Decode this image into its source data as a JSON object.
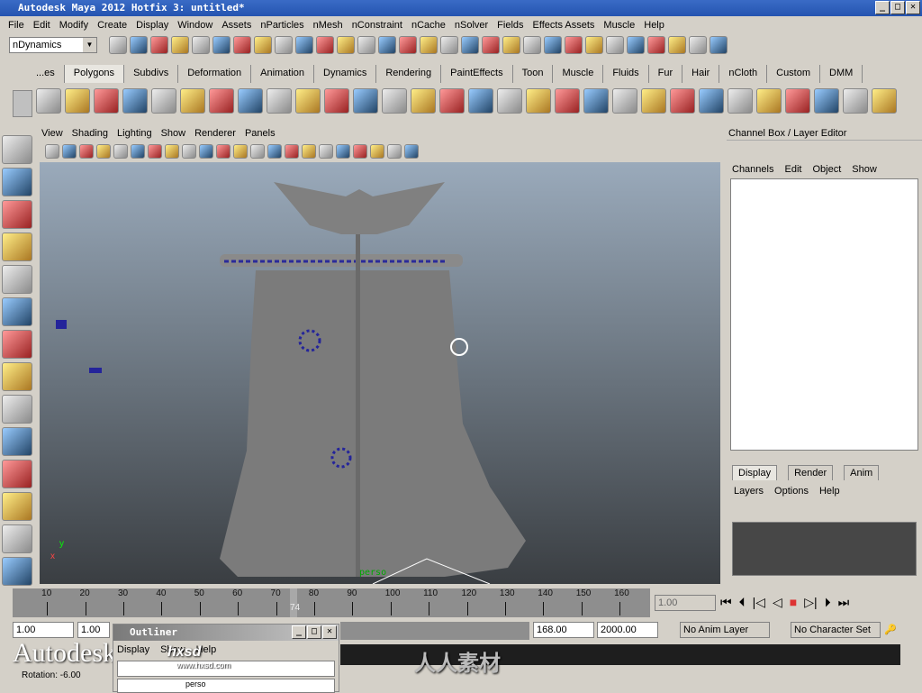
{
  "window": {
    "title": "Autodesk Maya 2012 Hotfix 3: untitled*"
  },
  "menu": [
    "File",
    "Edit",
    "Modify",
    "Create",
    "Display",
    "Window",
    "Assets",
    "nParticles",
    "nMesh",
    "nConstraint",
    "nCache",
    "nSolver",
    "Fields",
    "Effects Assets",
    "Muscle",
    "Help"
  ],
  "status_line": {
    "menu_set": "nDynamics"
  },
  "shelf_tabs": [
    "...es",
    "Polygons",
    "Subdivs",
    "Deformation",
    "Animation",
    "Dynamics",
    "Rendering",
    "PaintEffects",
    "Toon",
    "Muscle",
    "Fluids",
    "Fur",
    "Hair",
    "nCloth",
    "Custom",
    "DMM"
  ],
  "viewport": {
    "menu": [
      "View",
      "Shading",
      "Lighting",
      "Show",
      "Renderer",
      "Panels"
    ],
    "axis_y": "y",
    "axis_x": "x",
    "object_label": "perso"
  },
  "channel_box": {
    "title": "Channel Box / Layer Editor",
    "menu": [
      "Channels",
      "Edit",
      "Object",
      "Show"
    ],
    "tabs": [
      "Display",
      "Render",
      "Anim"
    ],
    "layer_menu": [
      "Layers",
      "Options",
      "Help"
    ]
  },
  "time_slider": {
    "ticks": [
      10,
      20,
      30,
      40,
      50,
      60,
      70,
      80,
      90,
      100,
      110,
      120,
      130,
      140,
      150,
      160
    ],
    "current_frame": "74",
    "current_time_field": "1.00"
  },
  "range_slider": {
    "start_time": "1.00",
    "playback_start": "1.00",
    "playback_end": "168.00",
    "end_time": "2000.00",
    "anim_layer": "No Anim Layer",
    "character_set": "No Character Set"
  },
  "outliner": {
    "title": "Outliner",
    "menu": [
      "Display",
      "Show",
      "Help"
    ],
    "item": "perso"
  },
  "help_line": {
    "text": "Rotation:  -6.00"
  },
  "watermarks": [
    "Autodesk",
    "www.hxsd.com",
    "人人素材"
  ]
}
